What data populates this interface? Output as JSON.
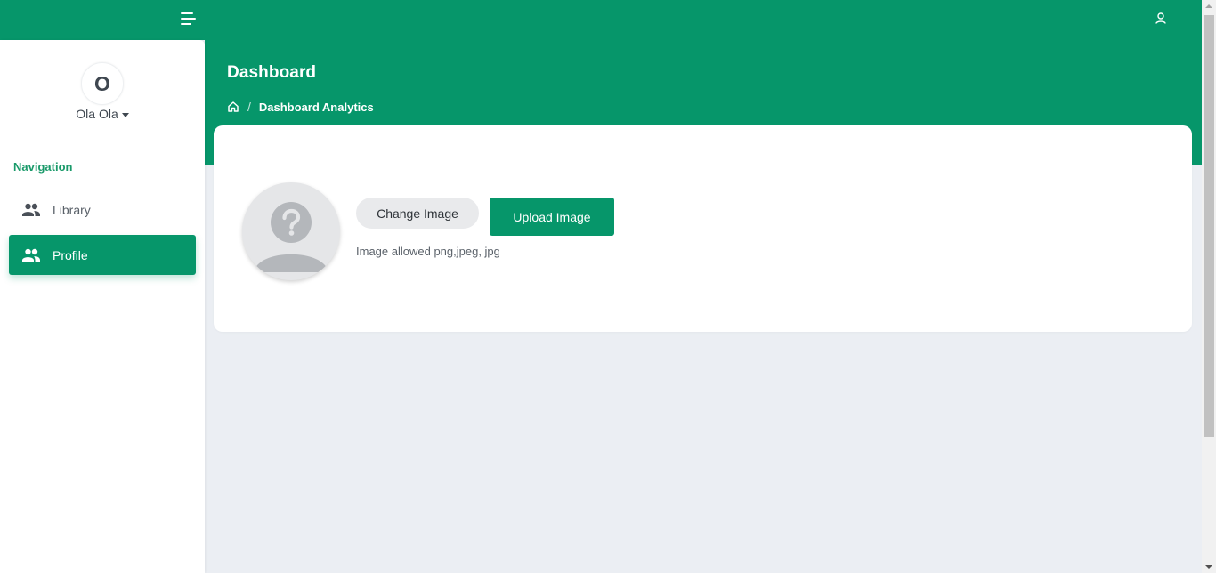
{
  "header": {
    "title": "Dashboard",
    "breadcrumb_current": "Dashboard Analytics"
  },
  "user": {
    "initial": "O",
    "name": "Ola Ola"
  },
  "sidebar": {
    "heading": "Navigation",
    "items": [
      {
        "label": "Library",
        "icon": "users-icon",
        "active": false
      },
      {
        "label": "Profile",
        "icon": "users-icon",
        "active": true
      }
    ]
  },
  "profile_image": {
    "change_label": "Change Image",
    "upload_label": "Upload Image",
    "hint": "Image allowed png,jpeg, jpg",
    "placeholder_icon": "unknown-person-icon"
  },
  "colors": {
    "brand": "#06966a",
    "page_bg": "#ebeef3",
    "accent_text": "#1a9a6a"
  }
}
